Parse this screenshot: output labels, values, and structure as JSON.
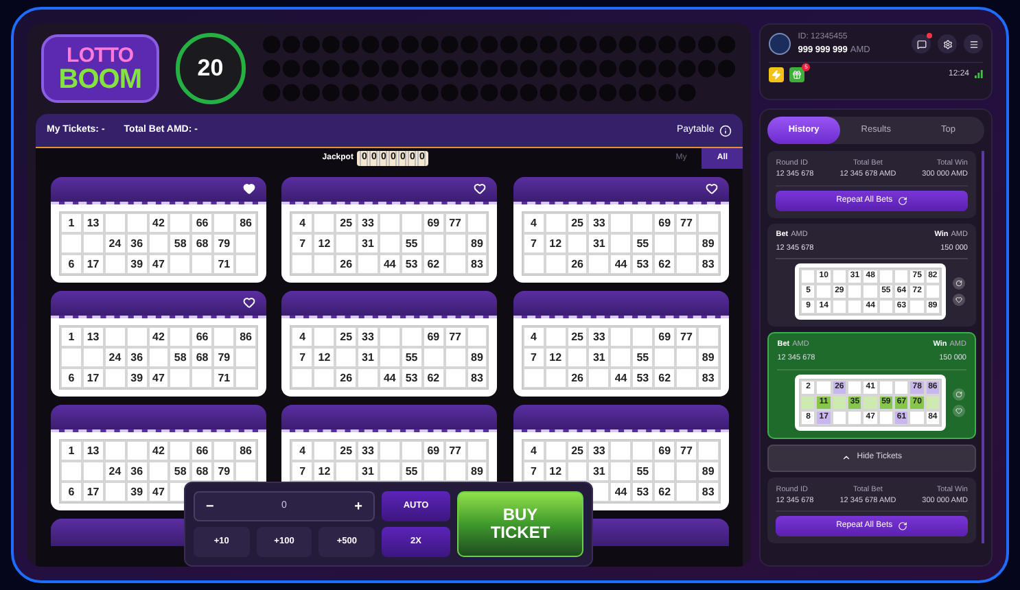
{
  "logo": {
    "top": "LOTTO",
    "bottom": "BOOM"
  },
  "current_ball": "20",
  "ticket_bar": {
    "my_tickets": "My Tickets: -",
    "total_bet": "Total Bet AMD: -",
    "paytable": "Paytable"
  },
  "jackpot": {
    "label": "Jackpot",
    "digits": [
      "0",
      "0",
      "0",
      "0",
      "0",
      "0",
      "0"
    ]
  },
  "filter": [
    {
      "label": "My",
      "selected": false
    },
    {
      "label": "All",
      "selected": true
    }
  ],
  "tickets": [
    {
      "favorite": true,
      "rows": [
        [
          "1",
          "13",
          null,
          null,
          "42",
          null,
          "66",
          null,
          "86"
        ],
        [
          null,
          null,
          "24",
          "36",
          null,
          "58",
          "68",
          "79",
          null
        ],
        [
          "6",
          "17",
          null,
          "39",
          "47",
          null,
          null,
          "71",
          null
        ]
      ]
    },
    {
      "favorite": false,
      "rows": [
        [
          "4",
          null,
          "25",
          "33",
          null,
          null,
          "69",
          "77",
          null
        ],
        [
          "7",
          "12",
          null,
          "31",
          null,
          "55",
          null,
          null,
          "89"
        ],
        [
          null,
          null,
          "26",
          null,
          "44",
          "53",
          "62",
          null,
          "83"
        ]
      ]
    },
    {
      "favorite": false,
      "rows": [
        [
          "4",
          null,
          "25",
          "33",
          null,
          null,
          "69",
          "77",
          null
        ],
        [
          "7",
          "12",
          null,
          "31",
          null,
          "55",
          null,
          null,
          "89"
        ],
        [
          null,
          null,
          "26",
          null,
          "44",
          "53",
          "62",
          null,
          "83"
        ]
      ]
    },
    {
      "favorite": false,
      "rows": [
        [
          "1",
          "13",
          null,
          null,
          "42",
          null,
          "66",
          null,
          "86"
        ],
        [
          null,
          null,
          "24",
          "36",
          null,
          "58",
          "68",
          "79",
          null
        ],
        [
          "6",
          "17",
          null,
          "39",
          "47",
          null,
          null,
          "71",
          null
        ]
      ]
    },
    {
      "rows": [
        [
          "4",
          null,
          "25",
          "33",
          null,
          null,
          "69",
          "77",
          null
        ],
        [
          "7",
          "12",
          null,
          "31",
          null,
          "55",
          null,
          null,
          "89"
        ],
        [
          null,
          null,
          "26",
          null,
          "44",
          "53",
          "62",
          null,
          "83"
        ]
      ]
    },
    {
      "rows": [
        [
          "4",
          null,
          "25",
          "33",
          null,
          null,
          "69",
          "77",
          null
        ],
        [
          "7",
          "12",
          null,
          "31",
          null,
          "55",
          null,
          null,
          "89"
        ],
        [
          null,
          null,
          "26",
          null,
          "44",
          "53",
          "62",
          null,
          "83"
        ]
      ]
    },
    {
      "rows": [
        [
          "1",
          "13",
          null,
          null,
          "42",
          null,
          "66",
          null,
          "86"
        ],
        [
          null,
          null,
          "24",
          "36",
          null,
          "58",
          "68",
          "79",
          null
        ],
        [
          "6",
          "17",
          null,
          "39",
          "47",
          null,
          null,
          null,
          null
        ]
      ]
    },
    {
      "rows": [
        [
          "4",
          null,
          "25",
          "33",
          null,
          null,
          "69",
          "77",
          null
        ],
        [
          "7",
          "12",
          null,
          "31",
          null,
          "55",
          null,
          null,
          "89"
        ],
        [
          null,
          null,
          null,
          null,
          null,
          null,
          null,
          null,
          null
        ]
      ]
    },
    {
      "rows": [
        [
          "4",
          null,
          "25",
          "33",
          null,
          null,
          "69",
          "77",
          null
        ],
        [
          "7",
          "12",
          null,
          "31",
          null,
          "55",
          null,
          null,
          "89"
        ],
        [
          null,
          null,
          null,
          null,
          "44",
          "53",
          "62",
          null,
          "83"
        ]
      ]
    }
  ],
  "bet_panel": {
    "minus": "−",
    "amount": "0",
    "plus": "+",
    "quick": [
      "+10",
      "+100",
      "+500"
    ],
    "auto": "AUTO",
    "double": "2X",
    "buy": "BUY TICKET"
  },
  "account": {
    "id": "ID: 12345455",
    "balance": "999 999 999",
    "currency": "AMD",
    "unread": true,
    "gift_badge": "5",
    "time": "12:24"
  },
  "tabs": [
    {
      "label": "History",
      "selected": true
    },
    {
      "label": "Results",
      "selected": false
    },
    {
      "label": "Top",
      "selected": false
    }
  ],
  "history": [
    {
      "kind": "round",
      "labels": [
        "Round ID",
        "Total Bet",
        "Total Win"
      ],
      "values": [
        "12 345 678",
        "12 345 678 AMD",
        "300 000 AMD"
      ],
      "button": "Repeat All Bets"
    },
    {
      "kind": "bet",
      "won": false,
      "bet_label": "Bet",
      "bet_currency": "AMD",
      "bet": "12 345 678",
      "win_label": "Win",
      "win_currency": "AMD",
      "win": "150 000",
      "ticket": [
        {
          "highlighted": false,
          "cells": [
            null,
            "10",
            null,
            "31",
            "48",
            null,
            null,
            "75",
            "82"
          ]
        },
        {
          "highlighted": false,
          "cells": [
            "5",
            null,
            "29",
            null,
            null,
            "55",
            "64",
            "72",
            null
          ]
        },
        {
          "highlighted": false,
          "cells": [
            "9",
            "14",
            null,
            null,
            "44",
            null,
            "63",
            null,
            "89"
          ]
        }
      ]
    },
    {
      "kind": "bet",
      "won": true,
      "bet_label": "Bet",
      "bet_currency": "AMD",
      "bet": "12 345 678",
      "win_label": "Win",
      "win_currency": "AMD",
      "win": "150 000",
      "ticket": [
        {
          "highlighted": false,
          "cells": [
            "2",
            null,
            {
              "n": "26",
              "hit": true
            },
            null,
            "41",
            null,
            null,
            {
              "n": "78",
              "hit": true
            },
            {
              "n": "86",
              "hit": true
            }
          ]
        },
        {
          "highlighted": true,
          "cells": [
            null,
            {
              "n": "11",
              "hit": true
            },
            null,
            {
              "n": "35",
              "hit": true
            },
            null,
            {
              "n": "59",
              "hit": true
            },
            {
              "n": "67",
              "hit": true
            },
            {
              "n": "70",
              "hit": true
            },
            null
          ]
        },
        {
          "highlighted": false,
          "cells": [
            "8",
            {
              "n": "17",
              "hit": true
            },
            null,
            null,
            "47",
            null,
            {
              "n": "61",
              "hit": true
            },
            null,
            "84"
          ]
        }
      ]
    },
    {
      "kind": "toggle",
      "label": "Hide Tickets"
    },
    {
      "kind": "round",
      "labels": [
        "Round ID",
        "Total Bet",
        "Total Win"
      ],
      "values": [
        "12 345 678",
        "12 345 678 AMD",
        "300 000 AMD"
      ],
      "button": "Repeat All Bets"
    }
  ]
}
